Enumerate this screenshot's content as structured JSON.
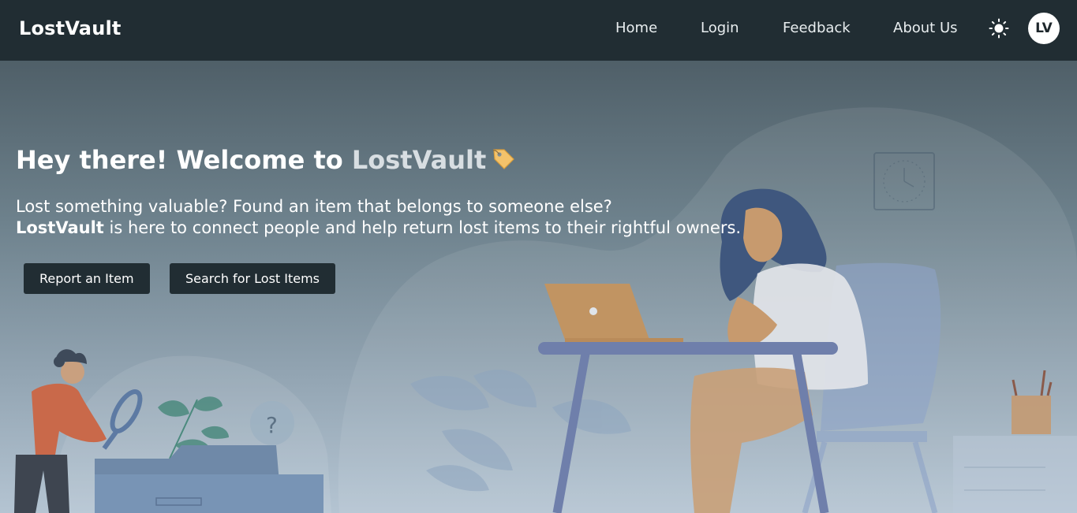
{
  "nav": {
    "brand": "LostVault",
    "links": [
      "Home",
      "Login",
      "Feedback",
      "About Us"
    ],
    "avatar": "LV",
    "theme_icon": "sun-icon"
  },
  "hero": {
    "title_prefix": "Hey there! Welcome to",
    "title_brand": "LostVault",
    "title_icon": "tag-icon",
    "line1": "Lost something valuable? Found an item that belongs to someone else?",
    "line2_brand": "LostVault",
    "line2_rest": "is here to connect people and help return lost items to their rightful owners.",
    "buttons": {
      "report": "Report an Item",
      "search": "Search for Lost Items"
    }
  },
  "colors": {
    "navbar": "#212d33",
    "button": "#212d33"
  }
}
